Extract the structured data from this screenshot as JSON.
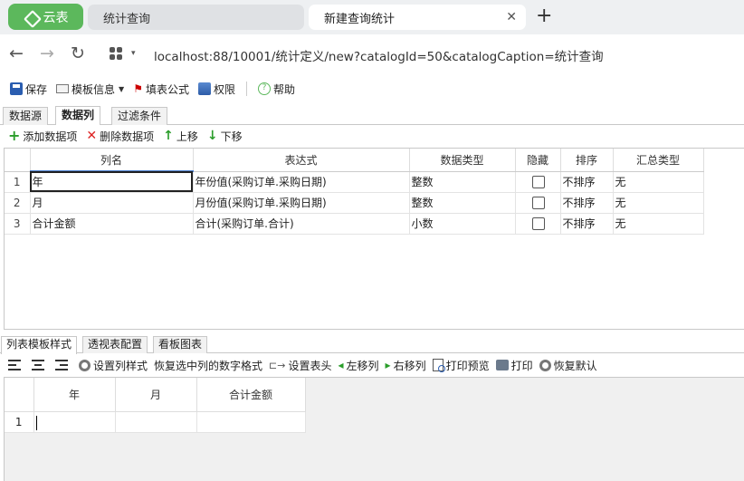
{
  "browser": {
    "app_button": "云表",
    "tabs": [
      {
        "label": "统计查询"
      },
      {
        "label": "新建查询统计"
      }
    ],
    "close_glyph": "✕",
    "newtab_glyph": "+",
    "url": "localhost:88/10001/统计定义/new?catalogId=50&catalogCaption=统计查询",
    "nav": {
      "back": "←",
      "forward": "→",
      "reload": "↻",
      "apps_caret": "▾"
    }
  },
  "toolbar": {
    "save": "保存",
    "template_info": "模板信息",
    "fill_formula": "填表公式",
    "permission": "权限",
    "help": "帮助"
  },
  "panel_tabs": [
    "数据源",
    "数据列",
    "过滤条件"
  ],
  "column_toolbar": {
    "add": "添加数据项",
    "delete": "删除数据项",
    "up": "上移",
    "down": "下移"
  },
  "column_grid": {
    "headers": [
      "",
      "列名",
      "表达式",
      "数据类型",
      "隐藏",
      "排序",
      "汇总类型"
    ],
    "rows": [
      {
        "no": "1",
        "name": "年",
        "expr": "年份值(采购订单.采购日期)",
        "type": "整数",
        "hidden": false,
        "sort": "不排序",
        "agg": "无"
      },
      {
        "no": "2",
        "name": "月",
        "expr": "月份值(采购订单.采购日期)",
        "type": "整数",
        "hidden": false,
        "sort": "不排序",
        "agg": "无"
      },
      {
        "no": "3",
        "name": "合计金额",
        "expr": "合计(采购订单.合计)",
        "type": "小数",
        "hidden": false,
        "sort": "不排序",
        "agg": "无"
      }
    ]
  },
  "lower_tabs": [
    "列表模板样式",
    "透视表配置",
    "看板图表"
  ],
  "lower_toolbar": {
    "set_col_style": "设置列样式",
    "restore_number_format": "恢复选中列的数字格式",
    "set_header": "设置表头",
    "move_left": "左移列",
    "move_right": "右移列",
    "print_preview": "打印预览",
    "print": "打印",
    "restore_default": "恢复默认"
  },
  "preview_grid": {
    "headers": [
      "",
      "年",
      "月",
      "合计金额"
    ],
    "rows": [
      {
        "no": "1"
      }
    ]
  }
}
